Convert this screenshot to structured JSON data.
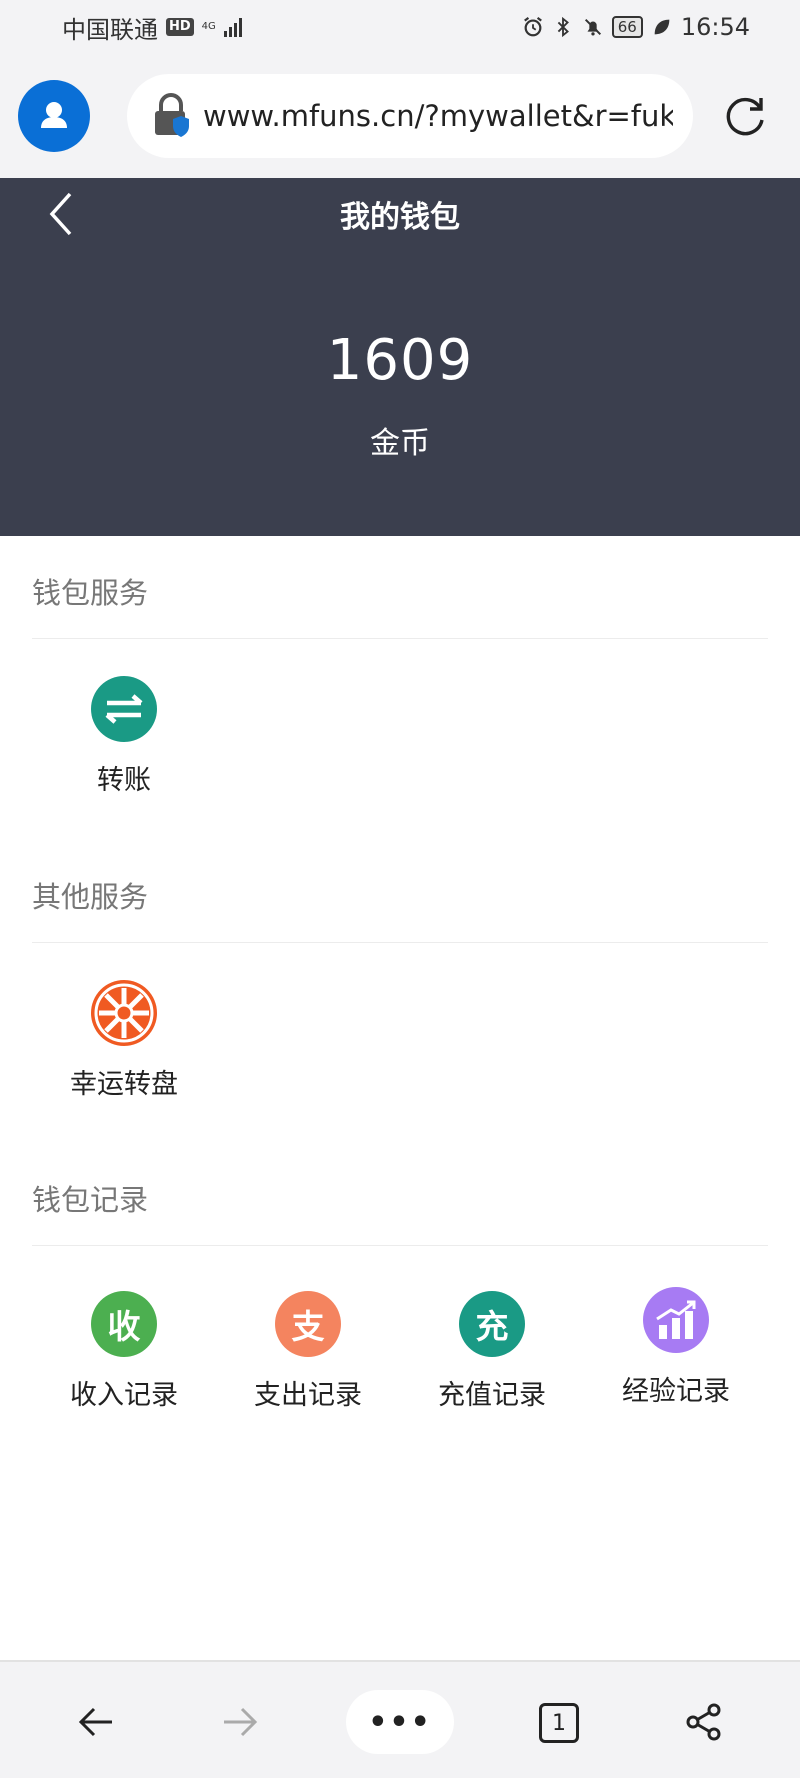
{
  "status_bar": {
    "carrier": "中国联通",
    "hd": "HD",
    "network": "4G",
    "battery": "66",
    "time": "16:54"
  },
  "browser": {
    "url": "www.mfuns.cn/?mywallet&r=fuku",
    "tab_count": "1",
    "more_label": "•••"
  },
  "header": {
    "title": "我的钱包",
    "balance": "1609",
    "unit": "金币"
  },
  "sections": {
    "wallet_services": {
      "title": "钱包服务",
      "items": [
        {
          "label": "转账",
          "icon": "transfer-icon",
          "color": "#1a9a85"
        }
      ]
    },
    "other_services": {
      "title": "其他服务",
      "items": [
        {
          "label": "幸运转盘",
          "icon": "wheel-icon",
          "color": "#f05a22"
        }
      ]
    },
    "wallet_records": {
      "title": "钱包记录",
      "items": [
        {
          "label": "收入记录",
          "glyph": "收",
          "color": "#4caf50"
        },
        {
          "label": "支出记录",
          "glyph": "支",
          "color": "#f4845f"
        },
        {
          "label": "充值记录",
          "glyph": "充",
          "color": "#1a9a85"
        },
        {
          "label": "经验记录",
          "icon": "chart-icon",
          "color": "#a77bf3"
        }
      ]
    }
  }
}
